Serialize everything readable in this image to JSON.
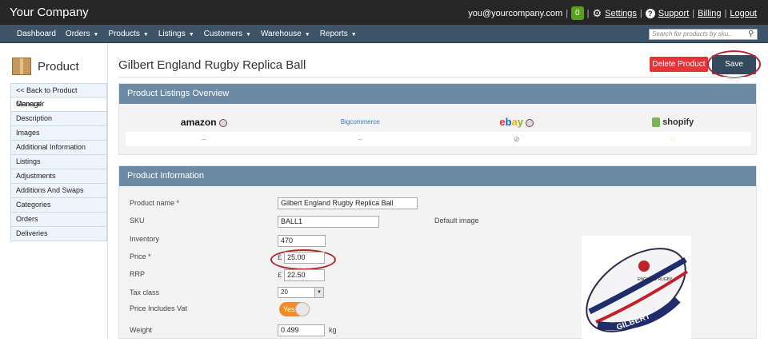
{
  "brand": "Your Company",
  "top": {
    "email": "you@yourcompany.com",
    "cart_count": "0",
    "settings": "Settings",
    "support": "Support",
    "billing": "Billing",
    "logout": "Logout"
  },
  "nav": [
    {
      "label": "Dashboard",
      "caret": false
    },
    {
      "label": "Orders",
      "caret": true
    },
    {
      "label": "Products",
      "caret": true
    },
    {
      "label": "Listings",
      "caret": true
    },
    {
      "label": "Customers",
      "caret": true
    },
    {
      "label": "Warehouse",
      "caret": true
    },
    {
      "label": "Reports",
      "caret": true
    }
  ],
  "search": {
    "placeholder": "Search for products by sku.."
  },
  "sidebar": {
    "title": "Product",
    "items": [
      "<< Back to Product Manager",
      "General",
      "Description",
      "Images",
      "Additional Information",
      "Listings",
      "Adjustments",
      "Additions And Swaps",
      "Categories",
      "Orders",
      "Deliveries"
    ],
    "active": "General"
  },
  "page": {
    "title": "Gilbert England Rugby Replica Ball",
    "delete_label": "Delete Product",
    "save_label": "Save"
  },
  "listings": {
    "title": "Product Listings Overview",
    "marketplaces": [
      {
        "name": "amazon",
        "status": "–"
      },
      {
        "name": "Bigcommerce",
        "status": "–"
      },
      {
        "name": "ebay",
        "status": "⊘"
      },
      {
        "name": "shopify",
        "status": "◌"
      }
    ]
  },
  "product": {
    "title": "Product Information",
    "name_label": "Product name *",
    "name_value": "Gilbert England Rugby Replica Ball",
    "sku_label": "SKU",
    "sku_value": "BALL1",
    "inventory_label": "Inventory",
    "inventory_value": "470",
    "price_label": "Price *",
    "price_value": "25.00",
    "rrp_label": "RRP",
    "rrp_value": "22.50",
    "tax_label": "Tax class",
    "tax_value": "20",
    "vat_label": "Price Includes Vat",
    "vat_value": "Yes",
    "weight_label": "Weight",
    "weight_value": "0.499",
    "weight_unit": "kg",
    "currency": "£",
    "default_image_label": "Default image",
    "ball_text": "ENGLAND RUGBY",
    "ball_brand": "GILBERT"
  },
  "colors": {
    "nav": "#3d5468",
    "panel_head": "#6d8aa4",
    "delete": "#e8333b",
    "save": "#34495e",
    "annotation": "#b3262c"
  }
}
